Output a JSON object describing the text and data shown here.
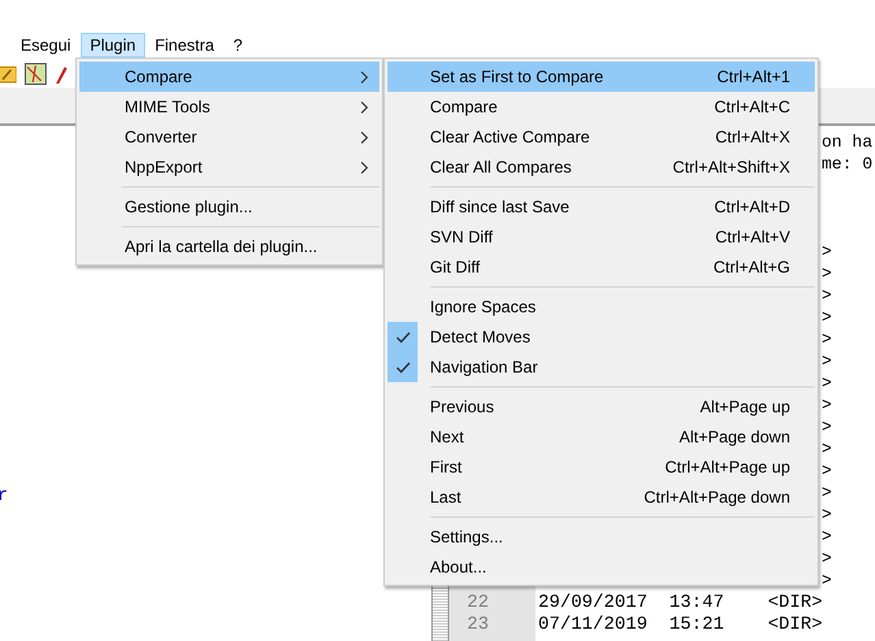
{
  "menu_bar": [
    {
      "label": "Esegui",
      "selected": false
    },
    {
      "label": "Plugin",
      "selected": true
    },
    {
      "label": "Finestra",
      "selected": false
    },
    {
      "label": "?",
      "selected": false
    }
  ],
  "plugin_menu": {
    "groups": [
      {
        "items": [
          {
            "label": "Compare",
            "has_submenu": true,
            "selected": true
          },
          {
            "label": "MIME Tools",
            "has_submenu": true,
            "selected": false
          },
          {
            "label": "Converter",
            "has_submenu": true,
            "selected": false
          },
          {
            "label": "NppExport",
            "has_submenu": true,
            "selected": false
          }
        ]
      },
      {
        "items": [
          {
            "label": "Gestione plugin...",
            "has_submenu": false,
            "selected": false
          }
        ]
      },
      {
        "items": [
          {
            "label": "Apri la cartella dei plugin...",
            "has_submenu": false,
            "selected": false
          }
        ]
      }
    ]
  },
  "compare_submenu": {
    "groups": [
      {
        "items": [
          {
            "label": "Set as First to Compare",
            "shortcut": "Ctrl+Alt+1",
            "checked": false,
            "selected": true
          },
          {
            "label": "Compare",
            "shortcut": "Ctrl+Alt+C",
            "checked": false,
            "selected": false
          },
          {
            "label": "Clear Active Compare",
            "shortcut": "Ctrl+Alt+X",
            "checked": false,
            "selected": false
          },
          {
            "label": "Clear All Compares",
            "shortcut": "Ctrl+Alt+Shift+X",
            "checked": false,
            "selected": false
          }
        ]
      },
      {
        "items": [
          {
            "label": "Diff since last Save",
            "shortcut": "Ctrl+Alt+D",
            "checked": false,
            "selected": false
          },
          {
            "label": "SVN Diff",
            "shortcut": "Ctrl+Alt+V",
            "checked": false,
            "selected": false
          },
          {
            "label": "Git Diff",
            "shortcut": "Ctrl+Alt+G",
            "checked": false,
            "selected": false
          }
        ]
      },
      {
        "items": [
          {
            "label": "Ignore Spaces",
            "checked": false,
            "selected": false
          },
          {
            "label": "Detect Moves",
            "checked": true,
            "selected": false
          },
          {
            "label": "Navigation Bar",
            "checked": true,
            "selected": false
          }
        ]
      },
      {
        "items": [
          {
            "label": "Previous",
            "shortcut": "Alt+Page up",
            "checked": false,
            "selected": false
          },
          {
            "label": "Next",
            "shortcut": "Alt+Page down",
            "checked": false,
            "selected": false
          },
          {
            "label": "First",
            "shortcut": "Ctrl+Alt+Page up",
            "checked": false,
            "selected": false
          },
          {
            "label": "Last",
            "shortcut": "Ctrl+Alt+Page down",
            "checked": false,
            "selected": false
          }
        ]
      },
      {
        "items": [
          {
            "label": "Settings...",
            "checked": false,
            "selected": false
          },
          {
            "label": "About...",
            "checked": false,
            "selected": false
          }
        ]
      }
    ]
  },
  "left_pane": {
    "text": "r"
  },
  "editor": {
    "top_line_ends": [
      "on ha",
      "me: 0"
    ],
    "line_ends": [
      ">",
      ">",
      ">",
      ">",
      ">",
      ">",
      ">",
      ">",
      ">",
      ">",
      ">",
      ">",
      ">",
      ">",
      ">",
      ">"
    ],
    "rows": [
      {
        "number": "22",
        "date": "29/09/2017",
        "time": "13:47",
        "type": "<DIR>"
      },
      {
        "number": "23",
        "date": "07/11/2019",
        "time": "15:21",
        "type": "<DIR>"
      }
    ]
  }
}
